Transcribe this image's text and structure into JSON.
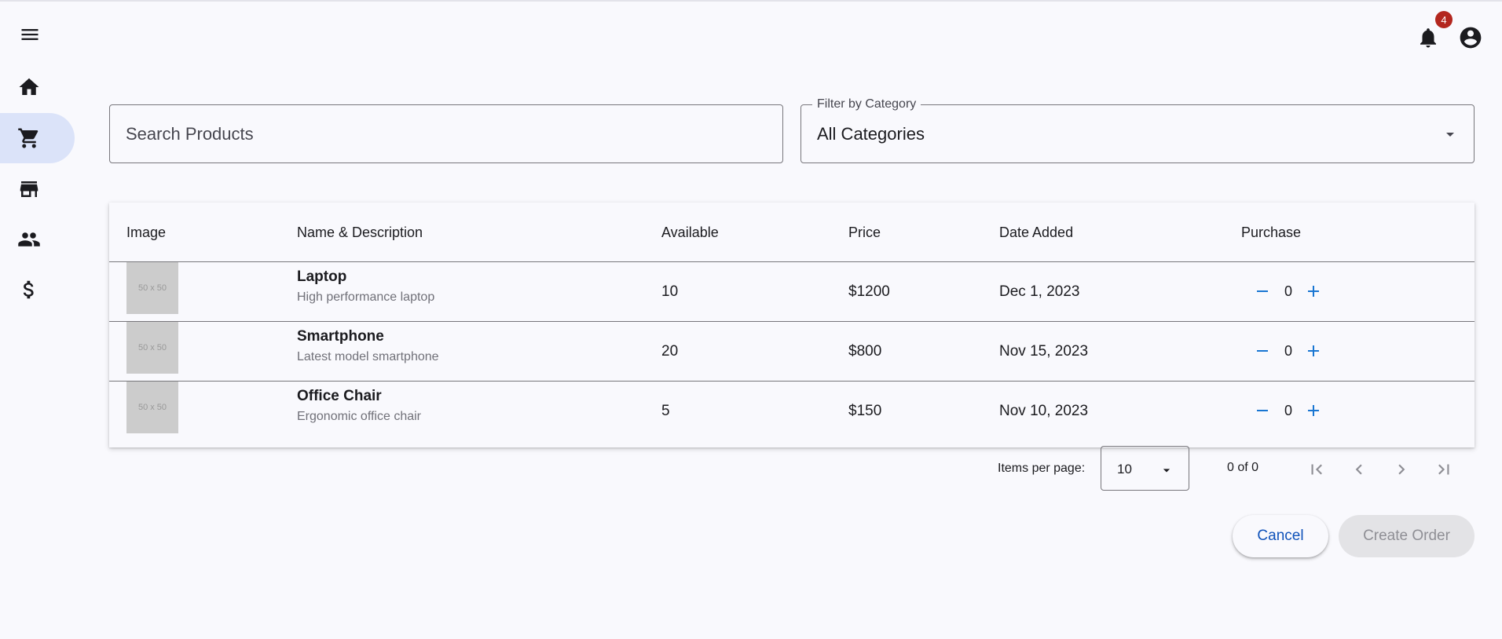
{
  "nav": {
    "menu_icon": "menu-icon",
    "items": [
      {
        "icon": "home-icon",
        "active": false
      },
      {
        "icon": "cart-icon",
        "active": true
      },
      {
        "icon": "store-icon",
        "active": false
      },
      {
        "icon": "people-icon",
        "active": false
      },
      {
        "icon": "dollar-icon",
        "active": false
      }
    ]
  },
  "topbar": {
    "notification_count": "4",
    "bell_icon": "bell-icon",
    "account_icon": "account-circle-icon"
  },
  "search": {
    "placeholder": "Search Products",
    "value": ""
  },
  "category_filter": {
    "label": "Filter by Category",
    "value": "All Categories"
  },
  "table": {
    "headers": [
      "Image",
      "Name & Description",
      "Available",
      "Price",
      "Date Added",
      "Purchase"
    ],
    "rows": [
      {
        "thumb": "50 x 50",
        "name": "Laptop",
        "description": "High performance laptop",
        "available": "10",
        "price": "$1200",
        "date": "Dec 1, 2023",
        "qty": "0"
      },
      {
        "thumb": "50 x 50",
        "name": "Smartphone",
        "description": "Latest model smartphone",
        "available": "20",
        "price": "$800",
        "date": "Nov 15, 2023",
        "qty": "0"
      },
      {
        "thumb": "50 x 50",
        "name": "Office Chair",
        "description": "Ergonomic office chair",
        "available": "5",
        "price": "$150",
        "date": "Nov 10, 2023",
        "qty": "0"
      }
    ]
  },
  "paginator": {
    "items_per_page_label": "Items per page:",
    "items_per_page": "10",
    "range": "0 of 0"
  },
  "actions": {
    "cancel": "Cancel",
    "create": "Create Order"
  },
  "colors": {
    "accent": "#0f52ba",
    "active_nav": "#dbe3f9",
    "badge": "#b3261e",
    "qty_icon": "#1976d2"
  }
}
